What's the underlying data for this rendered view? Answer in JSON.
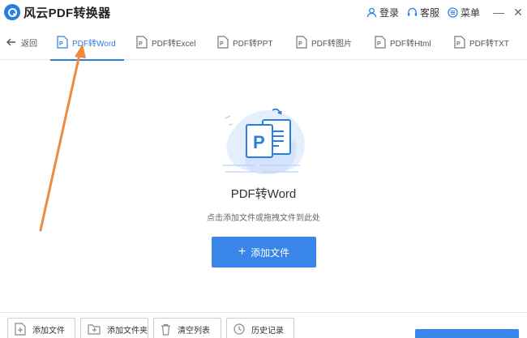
{
  "app": {
    "title": "风云PDF转换器"
  },
  "title_actions": {
    "login": "登录",
    "service": "客服",
    "menu": "菜单"
  },
  "window_buttons": {
    "minimize": "—",
    "close": "✕"
  },
  "nav": {
    "back_label": "返回"
  },
  "tabs": [
    {
      "label": "PDF转Word",
      "active": true
    },
    {
      "label": "PDF转Excel",
      "active": false
    },
    {
      "label": "PDF转PPT",
      "active": false
    },
    {
      "label": "PDF转图片",
      "active": false
    },
    {
      "label": "PDF转Html",
      "active": false
    },
    {
      "label": "PDF转TXT",
      "active": false
    }
  ],
  "main": {
    "title": "PDF转Word",
    "subtitle": "点击添加文件或拖拽文件到此处",
    "add_button": "添加文件",
    "add_plus": "+",
    "illustration_letter": "P"
  },
  "toolbar": {
    "add_file": "添加文件",
    "add_folder": "添加文件夹",
    "clear_list": "清空列表",
    "history": "历史记录"
  },
  "colors": {
    "accent": "#2a7de1",
    "annotation_arrow": "#f08a3c"
  }
}
